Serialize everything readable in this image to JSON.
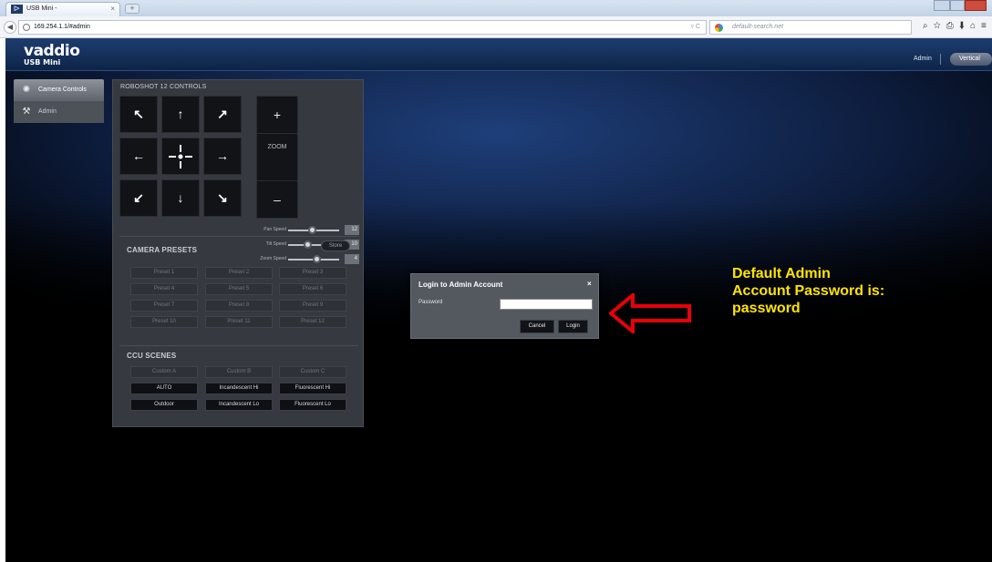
{
  "browser": {
    "tab_title": "USB Mini -",
    "tab_close": "×",
    "new_tab": "+",
    "url": "169.254.1.1/#admin",
    "url_controls": "▿ C",
    "search_placeholder": "default-search.net",
    "nav_icons": "⌕☆⎙⬇⌂≡"
  },
  "header": {
    "logo": "vaddio",
    "logo_sub": "USB Mini",
    "admin_link": "Admin",
    "vertical_button": "Vertical"
  },
  "sidebar": {
    "items": [
      {
        "label": "Camera Controls",
        "icon": "camera-aperture-icon",
        "active": true
      },
      {
        "label": "Admin",
        "icon": "wrench-icon",
        "active": false
      }
    ]
  },
  "controls": {
    "title": "ROBOSHOT 12 CONTROLS",
    "ptz": [
      "↖",
      "↑",
      "↗",
      "←",
      "home",
      "→",
      "↙",
      "↓",
      "↘"
    ],
    "zoom_in": "+",
    "zoom_label": "ZOOM",
    "zoom_out": "–",
    "speeds": [
      {
        "label": "Pan Speed",
        "value": "12",
        "level": 0.48
      },
      {
        "label": "Tilt Speed",
        "value": "10",
        "level": 0.4
      },
      {
        "label": "Zoom Speed",
        "value": "4",
        "level": 0.57
      }
    ]
  },
  "presets": {
    "title": "CAMERA PRESETS",
    "store": "Store",
    "items": [
      "Preset 1",
      "Preset 2",
      "Preset 3",
      "Preset 4",
      "Preset 5",
      "Preset 6",
      "Preset 7",
      "Preset 8",
      "Preset 9",
      "Preset 10",
      "Preset 11",
      "Preset 12"
    ]
  },
  "ccu": {
    "title": "CCU SCENES",
    "items": [
      {
        "label": "Custom A",
        "enabled": false
      },
      {
        "label": "Custom B",
        "enabled": false
      },
      {
        "label": "Custom C",
        "enabled": false
      },
      {
        "label": "AUTO",
        "enabled": true
      },
      {
        "label": "Incandescent Hi",
        "enabled": true
      },
      {
        "label": "Fluorescent Hi",
        "enabled": true
      },
      {
        "label": "Outdoor",
        "enabled": true
      },
      {
        "label": "Incandescent Lo",
        "enabled": true
      },
      {
        "label": "Fluorescent Lo",
        "enabled": true
      }
    ]
  },
  "login_dialog": {
    "title": "Login to Admin Account",
    "close": "×",
    "password_label": "Password",
    "password_value": "",
    "cancel": "Cancel",
    "login": "Login"
  },
  "annotation": {
    "lines": [
      "Default Admin",
      "Account Password is:",
      "password"
    ],
    "color": "#ffe400",
    "arrow_color": "#e8000a"
  }
}
